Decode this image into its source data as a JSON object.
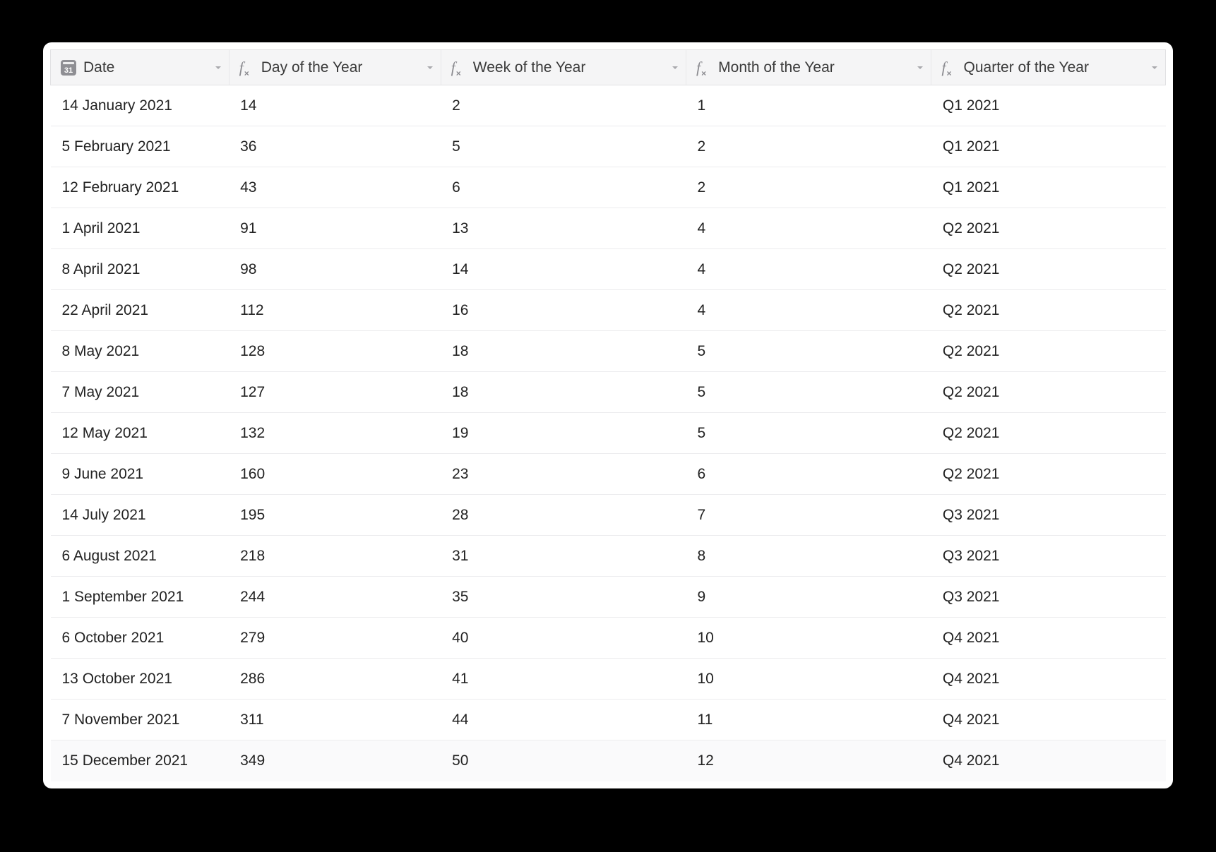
{
  "columns": [
    {
      "label": "Date",
      "type": "date"
    },
    {
      "label": "Day of the Year",
      "type": "formula"
    },
    {
      "label": "Week of the Year",
      "type": "formula"
    },
    {
      "label": "Month of the Year",
      "type": "formula"
    },
    {
      "label": "Quarter of the Year",
      "type": "formula"
    }
  ],
  "rows": [
    {
      "date": "14 January 2021",
      "day": "14",
      "week": "2",
      "month": "1",
      "quarter": "Q1 2021"
    },
    {
      "date": "5 February 2021",
      "day": "36",
      "week": "5",
      "month": "2",
      "quarter": "Q1 2021"
    },
    {
      "date": "12 February 2021",
      "day": "43",
      "week": "6",
      "month": "2",
      "quarter": "Q1 2021"
    },
    {
      "date": "1 April 2021",
      "day": "91",
      "week": "13",
      "month": "4",
      "quarter": "Q2 2021"
    },
    {
      "date": "8 April 2021",
      "day": "98",
      "week": "14",
      "month": "4",
      "quarter": "Q2 2021"
    },
    {
      "date": "22 April 2021",
      "day": "112",
      "week": "16",
      "month": "4",
      "quarter": "Q2 2021"
    },
    {
      "date": "8 May 2021",
      "day": "128",
      "week": "18",
      "month": "5",
      "quarter": "Q2 2021"
    },
    {
      "date": "7 May 2021",
      "day": "127",
      "week": "18",
      "month": "5",
      "quarter": "Q2 2021"
    },
    {
      "date": "12 May 2021",
      "day": "132",
      "week": "19",
      "month": "5",
      "quarter": "Q2 2021"
    },
    {
      "date": "9 June 2021",
      "day": "160",
      "week": "23",
      "month": "6",
      "quarter": "Q2 2021"
    },
    {
      "date": "14 July 2021",
      "day": "195",
      "week": "28",
      "month": "7",
      "quarter": "Q3 2021"
    },
    {
      "date": "6 August 2021",
      "day": "218",
      "week": "31",
      "month": "8",
      "quarter": "Q3 2021"
    },
    {
      "date": "1 September 2021",
      "day": "244",
      "week": "35",
      "month": "9",
      "quarter": "Q3 2021"
    },
    {
      "date": "6 October 2021",
      "day": "279",
      "week": "40",
      "month": "10",
      "quarter": "Q4 2021"
    },
    {
      "date": "13 October 2021",
      "day": "286",
      "week": "41",
      "month": "10",
      "quarter": "Q4 2021"
    },
    {
      "date": "7 November 2021",
      "day": "311",
      "week": "44",
      "month": "11",
      "quarter": "Q4 2021"
    },
    {
      "date": "15 December 2021",
      "day": "349",
      "week": "50",
      "month": "12",
      "quarter": "Q4 2021"
    }
  ],
  "alt_rows": [
    16
  ]
}
